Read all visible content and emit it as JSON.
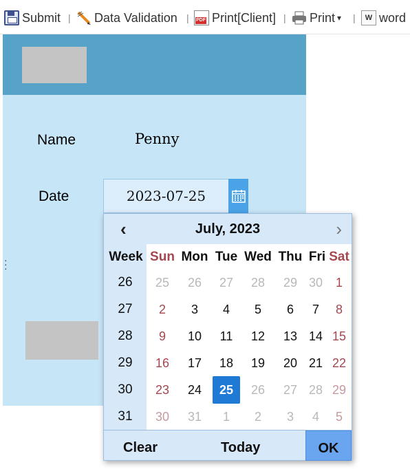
{
  "toolbar": {
    "submit": "Submit",
    "validation": "Data Validation",
    "print_client": "Print[Client]",
    "print": "Print",
    "print_caret": "▾",
    "word": "word",
    "separator": "|"
  },
  "form": {
    "name_label": "Name",
    "name_value": "Penny",
    "date_label": "Date",
    "date_value": "2023-07-25"
  },
  "calendar": {
    "prev": "‹",
    "next": "›",
    "title": "July, 2023",
    "week_header": "Week",
    "days": [
      "Sun",
      "Mon",
      "Tue",
      "Wed",
      "Thu",
      "Fri",
      "Sat"
    ],
    "weeks": [
      "26",
      "27",
      "28",
      "29",
      "30",
      "31"
    ],
    "rows": [
      [
        "25",
        "26",
        "27",
        "28",
        "29",
        "30",
        "1"
      ],
      [
        "2",
        "3",
        "4",
        "5",
        "6",
        "7",
        "8"
      ],
      [
        "9",
        "10",
        "11",
        "12",
        "13",
        "14",
        "15"
      ],
      [
        "16",
        "17",
        "18",
        "19",
        "20",
        "21",
        "22"
      ],
      [
        "23",
        "24",
        "25",
        "26",
        "27",
        "28",
        "29"
      ],
      [
        "30",
        "31",
        "1",
        "2",
        "3",
        "4",
        "5"
      ]
    ],
    "selected": "25",
    "clear": "Clear",
    "today": "Today",
    "ok": "OK"
  },
  "colors": {
    "header": "#57a3c8",
    "form_bg": "#c6e5f7",
    "accent": "#1f7ad6",
    "weekend": "#a5474f"
  }
}
